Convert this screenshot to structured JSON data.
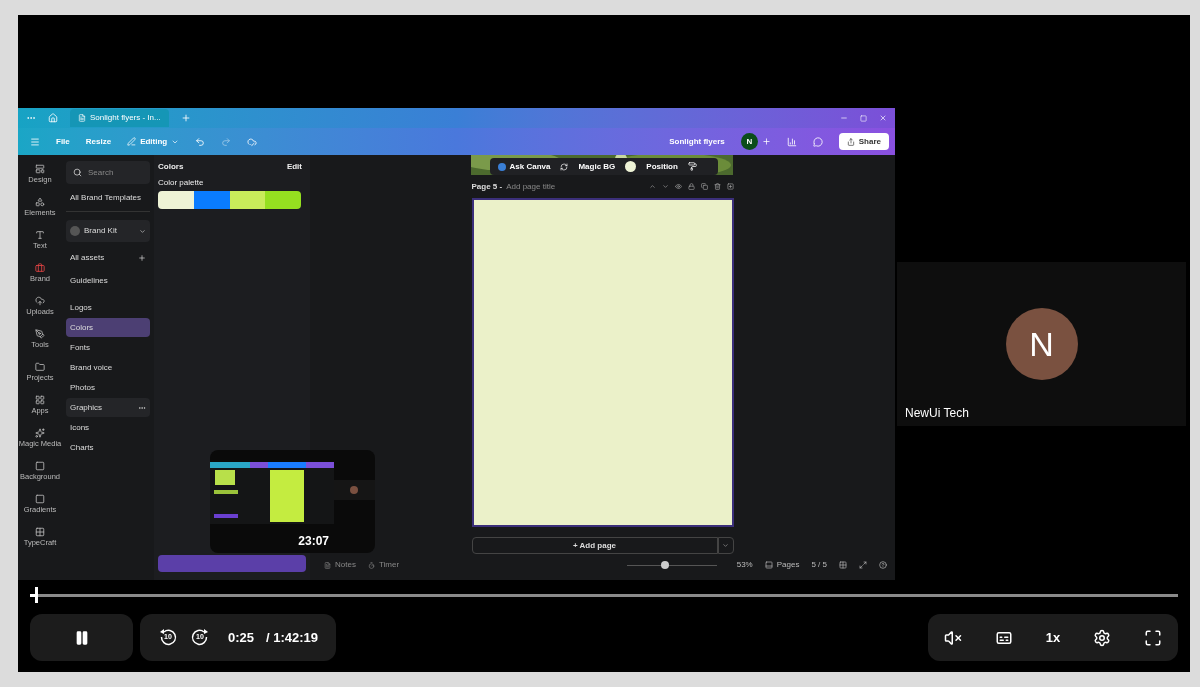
{
  "canva": {
    "tab_title": "Sonlight flyers - In...",
    "menu": [
      "File",
      "Resize",
      "Editing"
    ],
    "design_name": "Sonlight flyers",
    "avatar_initial": "N",
    "share": "Share",
    "rail": [
      {
        "label": "Design"
      },
      {
        "label": "Elements"
      },
      {
        "label": "Text"
      },
      {
        "label": "Brand"
      },
      {
        "label": "Uploads"
      },
      {
        "label": "Tools"
      },
      {
        "label": "Projects"
      },
      {
        "label": "Apps"
      },
      {
        "label": "Magic Media"
      },
      {
        "label": "Background"
      },
      {
        "label": "Gradients"
      },
      {
        "label": "TypeCraft"
      }
    ],
    "search": {
      "placeholder": "Search"
    },
    "all_brand_templates": "All Brand Templates",
    "brand_kit": "Brand Kit",
    "all_assets": "All assets",
    "nav": [
      {
        "label": "Guidelines",
        "selected": false,
        "hovered": false
      },
      {
        "label": "Logos",
        "selected": false,
        "hovered": false
      },
      {
        "label": "Colors",
        "selected": true,
        "hovered": false
      },
      {
        "label": "Fonts",
        "selected": false,
        "hovered": false
      },
      {
        "label": "Brand voice",
        "selected": false,
        "hovered": false
      },
      {
        "label": "Photos",
        "selected": false,
        "hovered": false
      },
      {
        "label": "Graphics",
        "selected": false,
        "hovered": true
      },
      {
        "label": "Icons",
        "selected": false,
        "hovered": false
      },
      {
        "label": "Charts",
        "selected": false,
        "hovered": false
      }
    ],
    "colors_title": "Colors",
    "edit": "Edit",
    "palette_label": "Color palette",
    "palette": [
      {
        "color": "#eef3d6"
      },
      {
        "color": "#0a7cff"
      },
      {
        "color": "#c8ec5a"
      },
      {
        "color": "#95e020"
      }
    ],
    "float_toolbar": {
      "ask": "Ask Canva",
      "magic_bg": "Magic BG",
      "position": "Position"
    },
    "page_label": "Page 5 -",
    "page_title": {
      "placeholder": "Add page title"
    },
    "add_page": "+ Add page",
    "notes": "Notes",
    "timer": "Timer",
    "zoom": {
      "level": 0.43
    },
    "zoom_reading": "53%",
    "pages": "Pages",
    "page_count": "5 / 5"
  },
  "preview": {
    "time": "23:07"
  },
  "participant": {
    "initial": "N",
    "name": "NewUi Tech"
  },
  "player": {
    "progress": {
      "level": 0.004
    },
    "playing": true,
    "skip_back": "10",
    "skip_forward": "10",
    "current": "0:25",
    "duration": "/ 1:42:19",
    "muted": true,
    "speed": "1x"
  }
}
